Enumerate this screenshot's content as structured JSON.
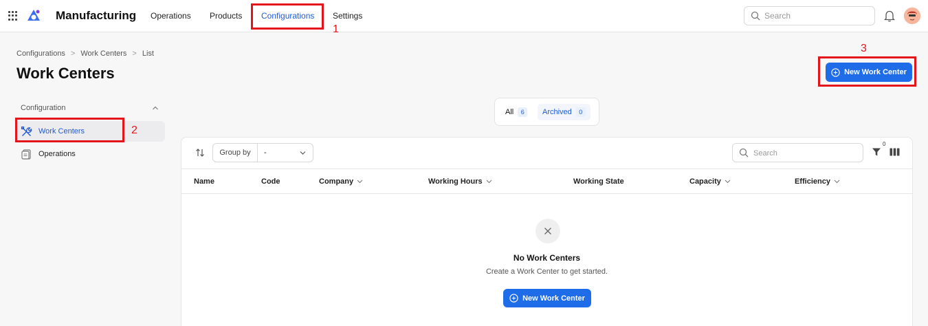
{
  "app": {
    "title": "Manufacturing"
  },
  "nav": [
    {
      "label": "Operations"
    },
    {
      "label": "Products"
    },
    {
      "label": "Configurations"
    },
    {
      "label": "Settings"
    }
  ],
  "top_search": {
    "placeholder": "Search"
  },
  "breadcrumb": [
    "Configurations",
    "Work Centers",
    "List"
  ],
  "breadcrumb_sep": ">",
  "page": {
    "title": "Work Centers",
    "new_button": "New Work Center"
  },
  "sidebar": {
    "header": "Configuration",
    "items": [
      {
        "label": "Work Centers",
        "icon": "tools-icon",
        "active": true
      },
      {
        "label": "Operations",
        "icon": "clipboard-icon",
        "active": false
      }
    ]
  },
  "tabs": [
    {
      "label": "All",
      "count": "6"
    },
    {
      "label": "Archived",
      "count": "0"
    }
  ],
  "toolbar": {
    "group_by_label": "Group by",
    "group_by_value": "-",
    "search_placeholder": "Search",
    "filter_count": "0"
  },
  "columns": [
    "Name",
    "Code",
    "Company",
    "Working Hours",
    "Working State",
    "Capacity",
    "Efficiency"
  ],
  "empty": {
    "title": "No Work Centers",
    "subtitle": "Create a Work Center to get started.",
    "button": "New Work Center"
  },
  "annotations": [
    "1",
    "2",
    "3"
  ],
  "colors": {
    "accent": "#1f6ce8",
    "annotation": "#e4141b"
  }
}
